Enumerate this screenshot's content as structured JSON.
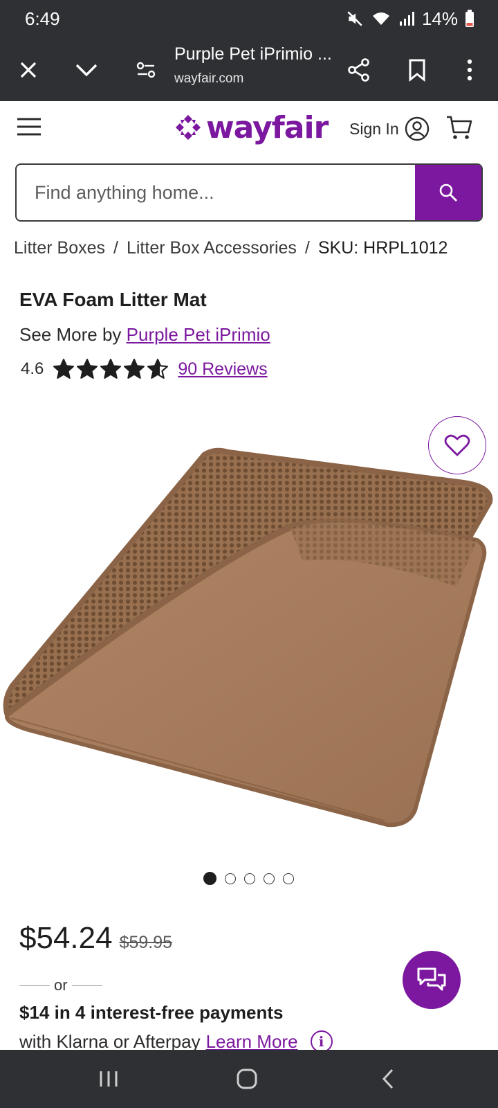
{
  "status_bar": {
    "time": "6:49",
    "battery": "14%",
    "icons": [
      "mute-icon",
      "wifi-icon",
      "signal-icon",
      "battery-icon"
    ]
  },
  "browser": {
    "page_title": "Purple Pet iPrimio ...",
    "url": "wayfair.com",
    "buttons": [
      "close-icon",
      "chevron-down-icon",
      "site-settings-icon",
      "share-icon",
      "bookmark-icon",
      "more-vert-icon"
    ]
  },
  "header": {
    "logo_text": "wayfair",
    "sign_in_label": "Sign In",
    "icons": [
      "menu-icon",
      "account-icon",
      "cart-icon"
    ]
  },
  "search": {
    "placeholder": "Find anything home...",
    "button_icon": "search-icon"
  },
  "breadcrumb": {
    "items": [
      "Litter Boxes",
      "Litter Box Accessories",
      "SKU: HRPL1012"
    ],
    "separator": "/"
  },
  "product": {
    "title": "EVA Foam Litter Mat",
    "brand_prefix": "See More by ",
    "brand_name": "Purple Pet iPrimio",
    "rating": "4.6",
    "rating_value": 4.6,
    "rating_max": 5,
    "reviews_label": "90 Reviews"
  },
  "gallery": {
    "image_count": 5,
    "active_index": 0,
    "favorite_icon": "heart-icon"
  },
  "pricing": {
    "current_price": "$54.24",
    "original_price": "$59.95",
    "or_label": "or",
    "installments": "$14 in 4 interest-free payments",
    "provider_text": "with Klarna or Afterpay",
    "learn_more_label": "Learn More",
    "info_icon_glyph": "i"
  },
  "chat": {
    "icon": "chat-icon"
  },
  "nav_bar": {
    "buttons": [
      "recents-icon",
      "home-icon",
      "back-icon"
    ]
  },
  "colors": {
    "brand": "#7b189f",
    "chrome": "#2f3034",
    "mat": "#a37b5e",
    "battery_low": "#e0584a"
  }
}
